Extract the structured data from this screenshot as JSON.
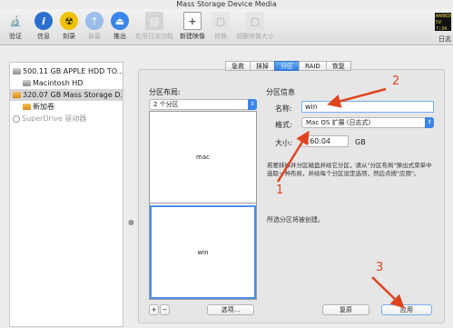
{
  "window": {
    "title": "Mass Storage Device Media"
  },
  "toolbar": {
    "items": [
      {
        "label": "验证",
        "icon": "microscope-icon"
      },
      {
        "label": "信息",
        "icon": "info-icon"
      },
      {
        "label": "刻录",
        "icon": "burn-icon"
      },
      {
        "label": "装载",
        "icon": "mount-icon"
      },
      {
        "label": "推出",
        "icon": "eject-icon"
      },
      {
        "label": "启用日志功能",
        "icon": "journal-icon"
      },
      {
        "label": "新建映像",
        "icon": "new-image-icon"
      },
      {
        "label": "转换",
        "icon": "convert-icon"
      },
      {
        "label": "调整映像大小",
        "icon": "resize-image-icon"
      }
    ],
    "log_icon_text": "WARNIN\n5V 7:34",
    "log_label": "日志"
  },
  "sidebar": {
    "items": [
      {
        "label": "500.11 GB APPLE HDD TO..."
      },
      {
        "label": "Macintosh HD"
      },
      {
        "label": "320.07 GB Mass Storage D..."
      },
      {
        "label": "新加卷"
      },
      {
        "label": "SuperDrive 驱动器"
      }
    ]
  },
  "tabs": [
    "急救",
    "抹掉",
    "分区",
    "RAID",
    "恢复"
  ],
  "layout": {
    "heading": "分区布局:",
    "select_value": "2 个分区",
    "partitions": [
      "mac",
      "win"
    ],
    "add_label": "+",
    "remove_label": "−",
    "options_label": "选项..."
  },
  "info": {
    "heading": "分区信息",
    "name_label": "名称:",
    "name_value": "win",
    "format_label": "格式:",
    "format_value": "Mac OS 扩展 (日志式)",
    "size_label": "大小:",
    "size_value": "160.04",
    "size_unit": "GB",
    "description": "若要抹掉并分区磁盘并给它分区，请从\"分区布局\"弹出式菜单中选取一种布局，并给每个分区设定选项，然后点按\"应用\"。",
    "status": "所选分区将被创建。",
    "revert_label": "复原",
    "apply_label": "应用"
  },
  "annotations": [
    "1",
    "2",
    "3"
  ],
  "colors": {
    "accent": "#2f7fe3",
    "annotation": "#e0441f"
  }
}
